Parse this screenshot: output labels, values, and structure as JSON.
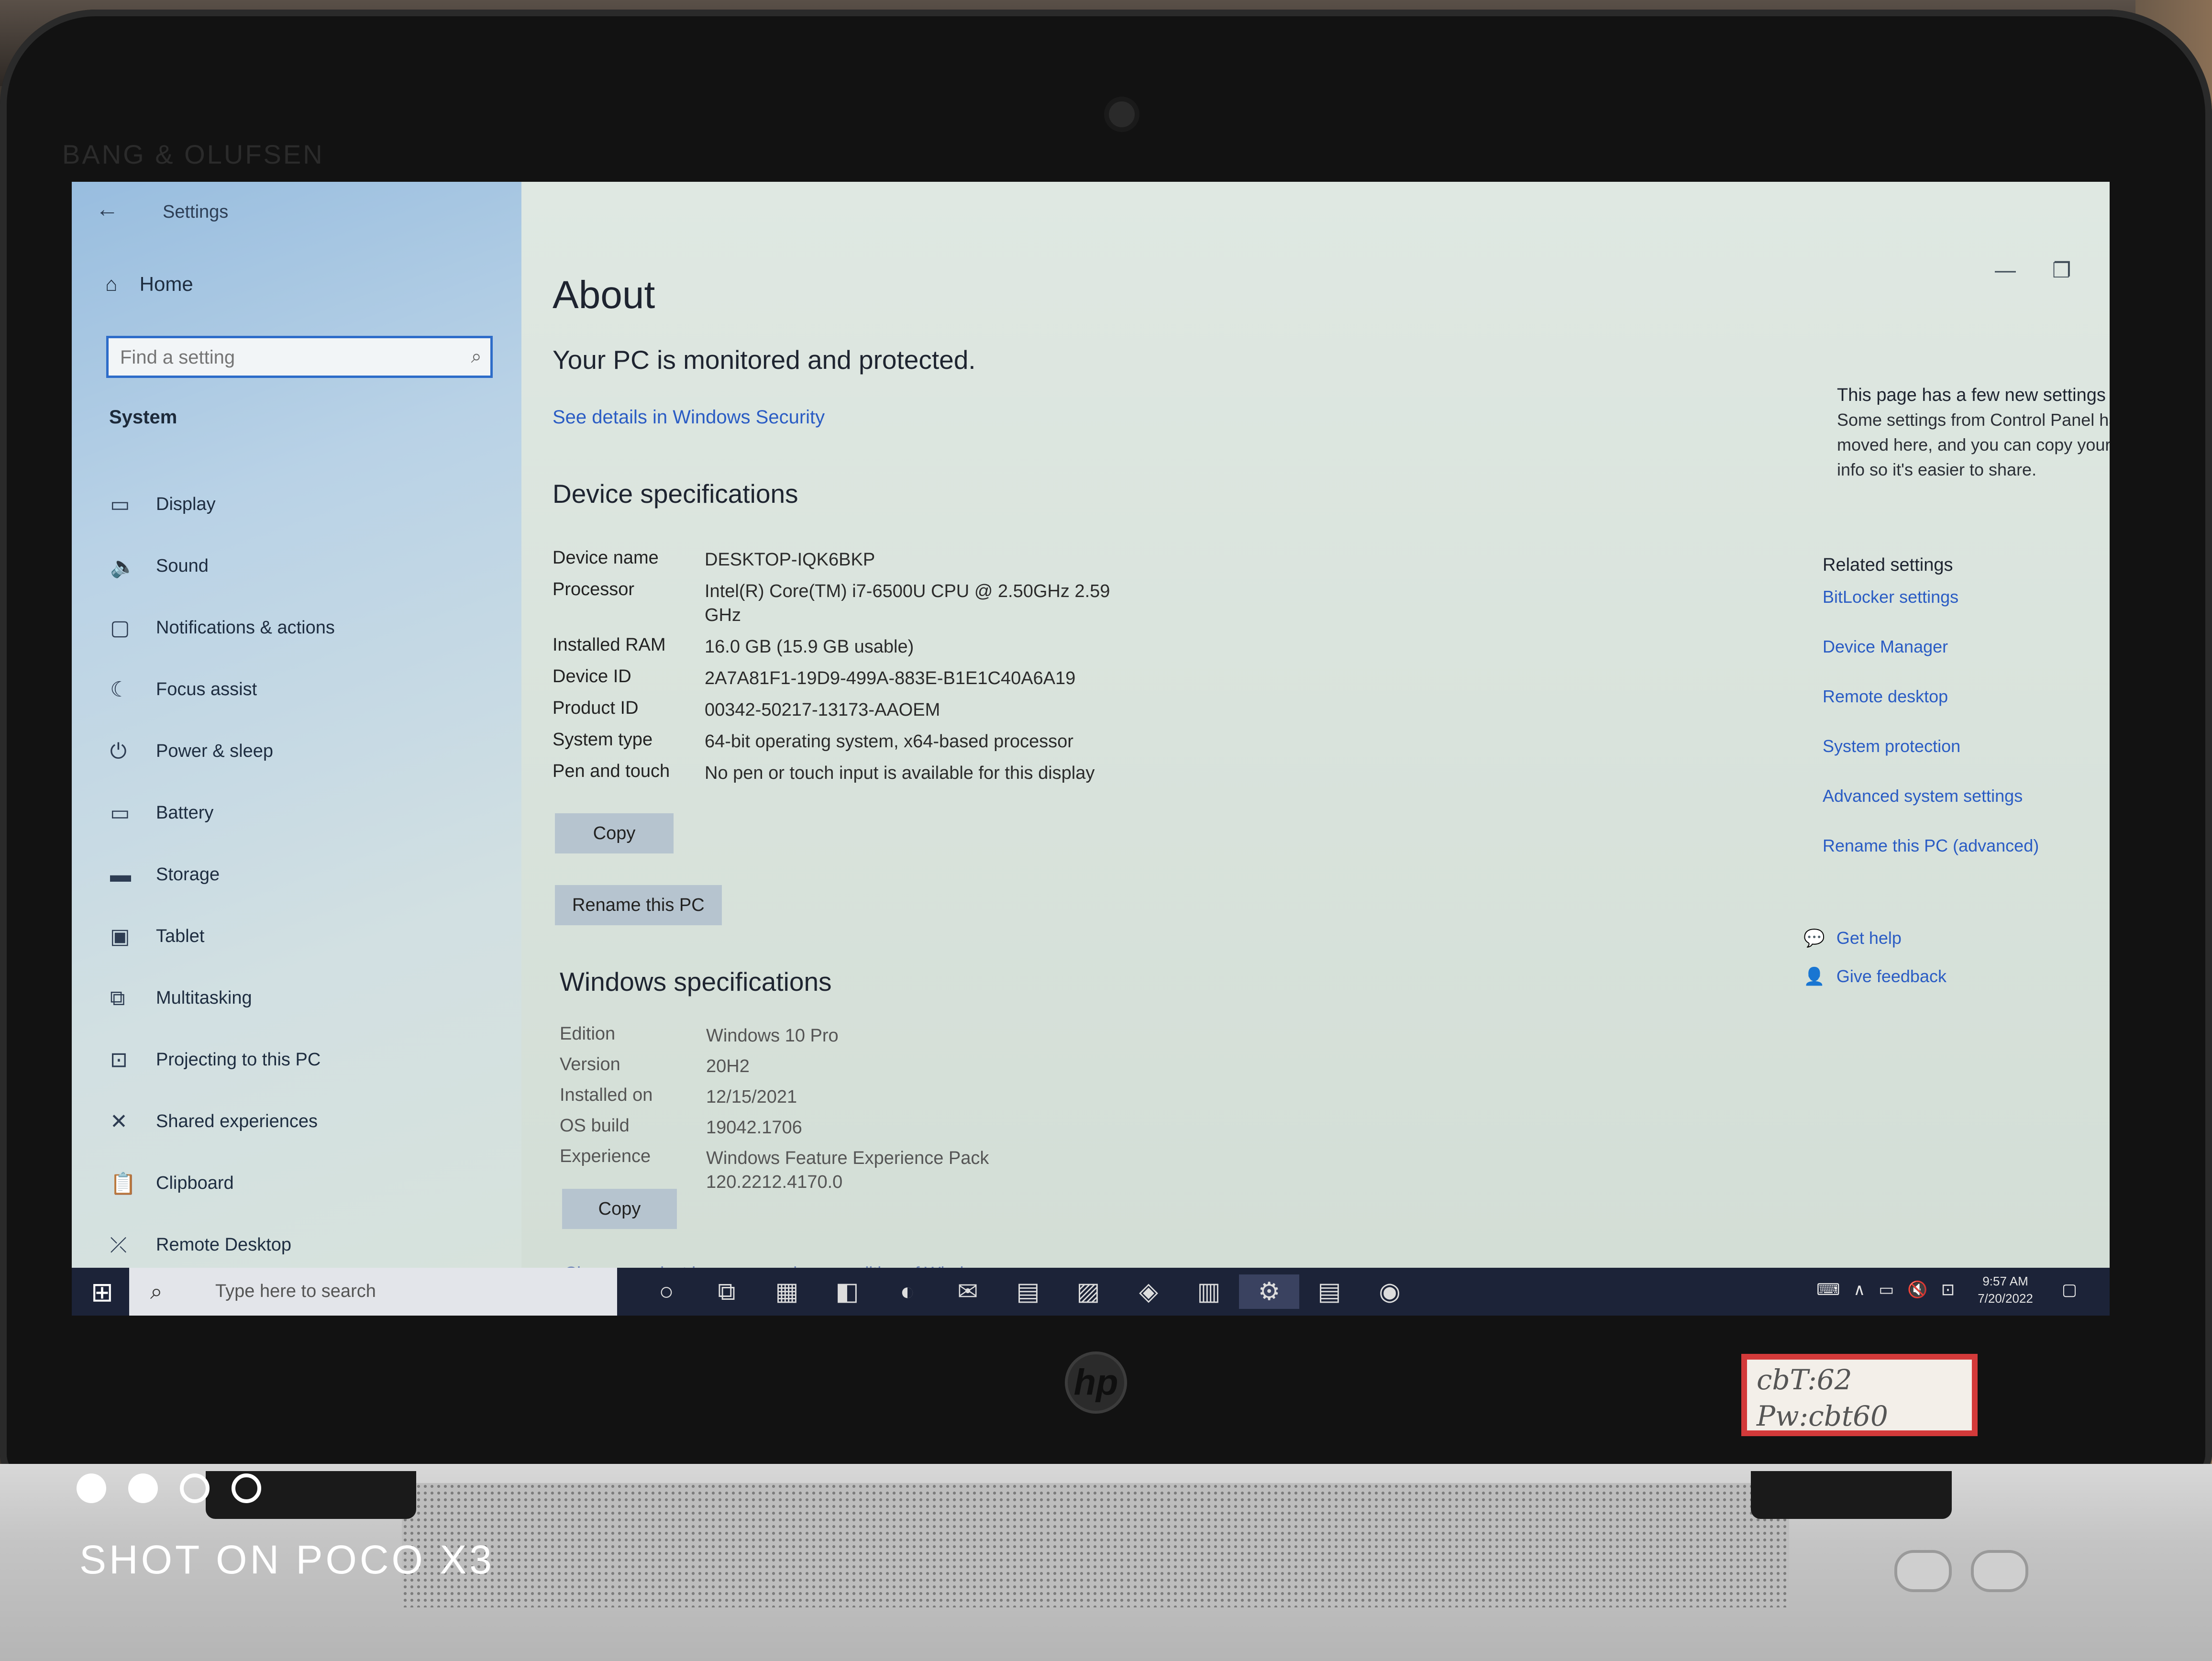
{
  "window": {
    "title": "Settings",
    "back_icon": "←",
    "controls": {
      "minimize": "—",
      "restore": "❐",
      "close": "✕"
    }
  },
  "sidebar": {
    "home_label": "Home",
    "search_placeholder": "Find a setting",
    "section_label": "System",
    "items": [
      {
        "label": "Display",
        "icon": "monitor-icon",
        "glyph": "▭"
      },
      {
        "label": "Sound",
        "icon": "speaker-icon",
        "glyph": "🔈"
      },
      {
        "label": "Notifications & actions",
        "icon": "message-icon",
        "glyph": "▢"
      },
      {
        "label": "Focus assist",
        "icon": "moon-icon",
        "glyph": "☾"
      },
      {
        "label": "Power & sleep",
        "icon": "power-icon",
        "glyph": "⏻"
      },
      {
        "label": "Battery",
        "icon": "battery-icon",
        "glyph": "▭"
      },
      {
        "label": "Storage",
        "icon": "drive-icon",
        "glyph": "▬"
      },
      {
        "label": "Tablet",
        "icon": "tablet-icon",
        "glyph": "▣"
      },
      {
        "label": "Multitasking",
        "icon": "multitask-icon",
        "glyph": "⧉"
      },
      {
        "label": "Projecting to this PC",
        "icon": "project-icon",
        "glyph": "⊡"
      },
      {
        "label": "Shared experiences",
        "icon": "share-icon",
        "glyph": "✕"
      },
      {
        "label": "Clipboard",
        "icon": "clipboard-icon",
        "glyph": "📋"
      },
      {
        "label": "Remote Desktop",
        "icon": "remote-icon",
        "glyph": "⤫"
      }
    ]
  },
  "main": {
    "title": "About",
    "protection_status": "Your PC is monitored and protected.",
    "security_link": "See details in Windows Security",
    "device_heading": "Device specifications",
    "device_specs": [
      {
        "key": "Device name",
        "value": "DESKTOP-IQK6BKP"
      },
      {
        "key": "Processor",
        "value": "Intel(R) Core(TM) i7-6500U CPU @ 2.50GHz   2.59 GHz"
      },
      {
        "key": "Installed RAM",
        "value": "16.0 GB (15.9 GB usable)"
      },
      {
        "key": "Device ID",
        "value": "2A7A81F1-19D9-499A-883E-B1E1C40A6A19"
      },
      {
        "key": "Product ID",
        "value": "00342-50217-13173-AAOEM"
      },
      {
        "key": "System type",
        "value": "64-bit operating system, x64-based processor"
      },
      {
        "key": "Pen and touch",
        "value": "No pen or touch input is available for this display"
      }
    ],
    "copy_button": "Copy",
    "rename_button": "Rename this PC",
    "windows_heading": "Windows specifications",
    "windows_specs": [
      {
        "key": "Edition",
        "value": "Windows 10 Pro"
      },
      {
        "key": "Version",
        "value": "20H2"
      },
      {
        "key": "Installed on",
        "value": "12/15/2021"
      },
      {
        "key": "OS build",
        "value": "19042.1706"
      },
      {
        "key": "Experience",
        "value": "Windows Feature Experience Pack 120.2212.4170.0"
      }
    ],
    "copy_button_2": "Copy",
    "change_key_link": "Change product key or upgrade your edition of Windows"
  },
  "right_panel": {
    "note_heading": "This page has a few new settings",
    "note_body": "Some settings from Control Panel have moved here, and you can copy your PC info so it's easier to share.",
    "related_heading": "Related settings",
    "related_links": [
      "BitLocker settings",
      "Device Manager",
      "Remote desktop",
      "System protection",
      "Advanced system settings",
      "Rename this PC (advanced)"
    ],
    "get_help": "Get help",
    "give_feedback": "Give feedback"
  },
  "taskbar": {
    "search_placeholder": "Type here to search",
    "apps": [
      {
        "name": "cortana-icon",
        "glyph": "○"
      },
      {
        "name": "task-view-icon",
        "glyph": "⧉"
      },
      {
        "name": "store-icon",
        "glyph": "▦"
      },
      {
        "name": "office-icon",
        "glyph": "◧"
      },
      {
        "name": "edge-icon",
        "glyph": "◐"
      },
      {
        "name": "mail-icon",
        "glyph": "✉"
      },
      {
        "name": "file-explorer-icon",
        "glyph": "▤"
      },
      {
        "name": "photos-icon",
        "glyph": "▨"
      },
      {
        "name": "teams-icon",
        "glyph": "◈"
      },
      {
        "name": "notepad-icon",
        "glyph": "▥"
      },
      {
        "name": "settings-icon",
        "glyph": "⚙"
      },
      {
        "name": "sheets-icon",
        "glyph": "▤"
      },
      {
        "name": "chrome-icon",
        "glyph": "◉"
      }
    ],
    "time": "9:57 AM",
    "date": "7/20/2022"
  },
  "physical": {
    "bezel_brand": "BANG & OLUFSEN",
    "logo_text": "hp",
    "sticker_line1": "cbT:62",
    "sticker_line2": "Pw:cbt60",
    "camera_watermark": "SHOT ON POCO X3"
  }
}
